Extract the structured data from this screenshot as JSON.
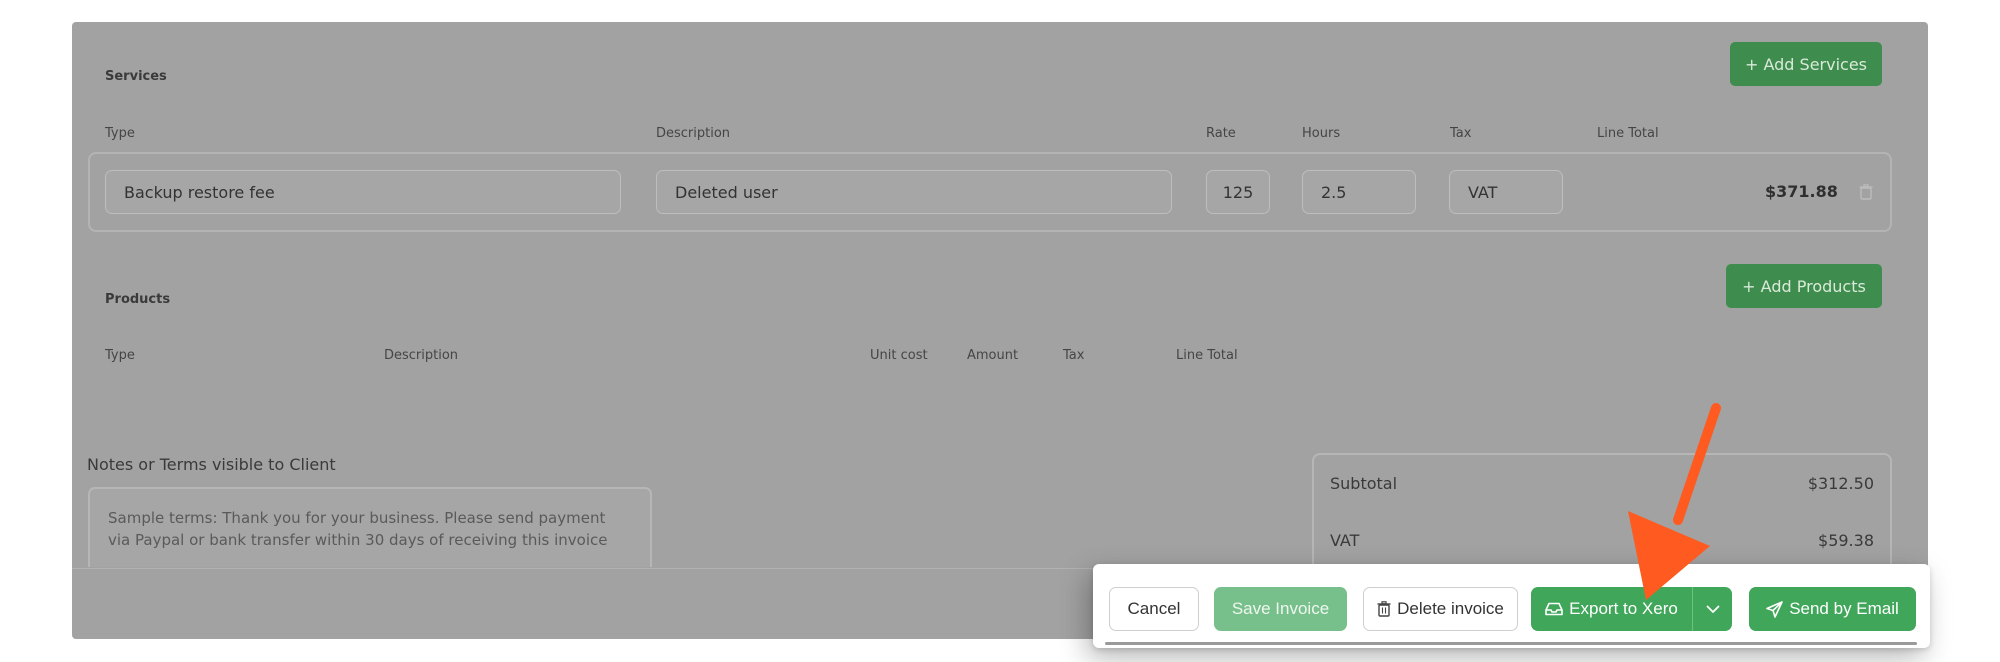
{
  "services": {
    "title": "Services",
    "add_button": "+ Add Services",
    "columns": [
      "Type",
      "Description",
      "Rate",
      "Hours",
      "Tax",
      "Line Total"
    ],
    "row": {
      "type": "Backup restore fee",
      "description": "Deleted user",
      "rate": "125",
      "hours": "2.5",
      "tax": "VAT",
      "line_total": "$371.88"
    }
  },
  "products": {
    "title": "Products",
    "add_button": "+ Add Products",
    "columns": [
      "Type",
      "Description",
      "Unit cost",
      "Amount",
      "Tax",
      "Line Total"
    ]
  },
  "notes": {
    "label": "Notes or Terms visible to Client",
    "text_line1": "Sample terms: Thank you for your business. Please send payment",
    "text_line2": "via Paypal or bank transfer within 30 days of receiving this invoice"
  },
  "totals": {
    "subtotal_label": "Subtotal",
    "subtotal_value": "$312.50",
    "vat_label": "VAT",
    "vat_value": "$59.38"
  },
  "actions": {
    "cancel": "Cancel",
    "save": "Save Invoice",
    "delete": "Delete invoice",
    "export": "Export to Xero",
    "send": "Send by Email"
  },
  "colors": {
    "primary_green": "#3fa65a",
    "disabled_green": "#78c08b",
    "arrow_orange": "#ff5a1f",
    "overlay_gray": "#a2a2a2"
  },
  "icons": [
    "trash-icon",
    "inbox-icon",
    "chevron-down-icon",
    "paper-plane-icon",
    "annotation-arrow"
  ]
}
